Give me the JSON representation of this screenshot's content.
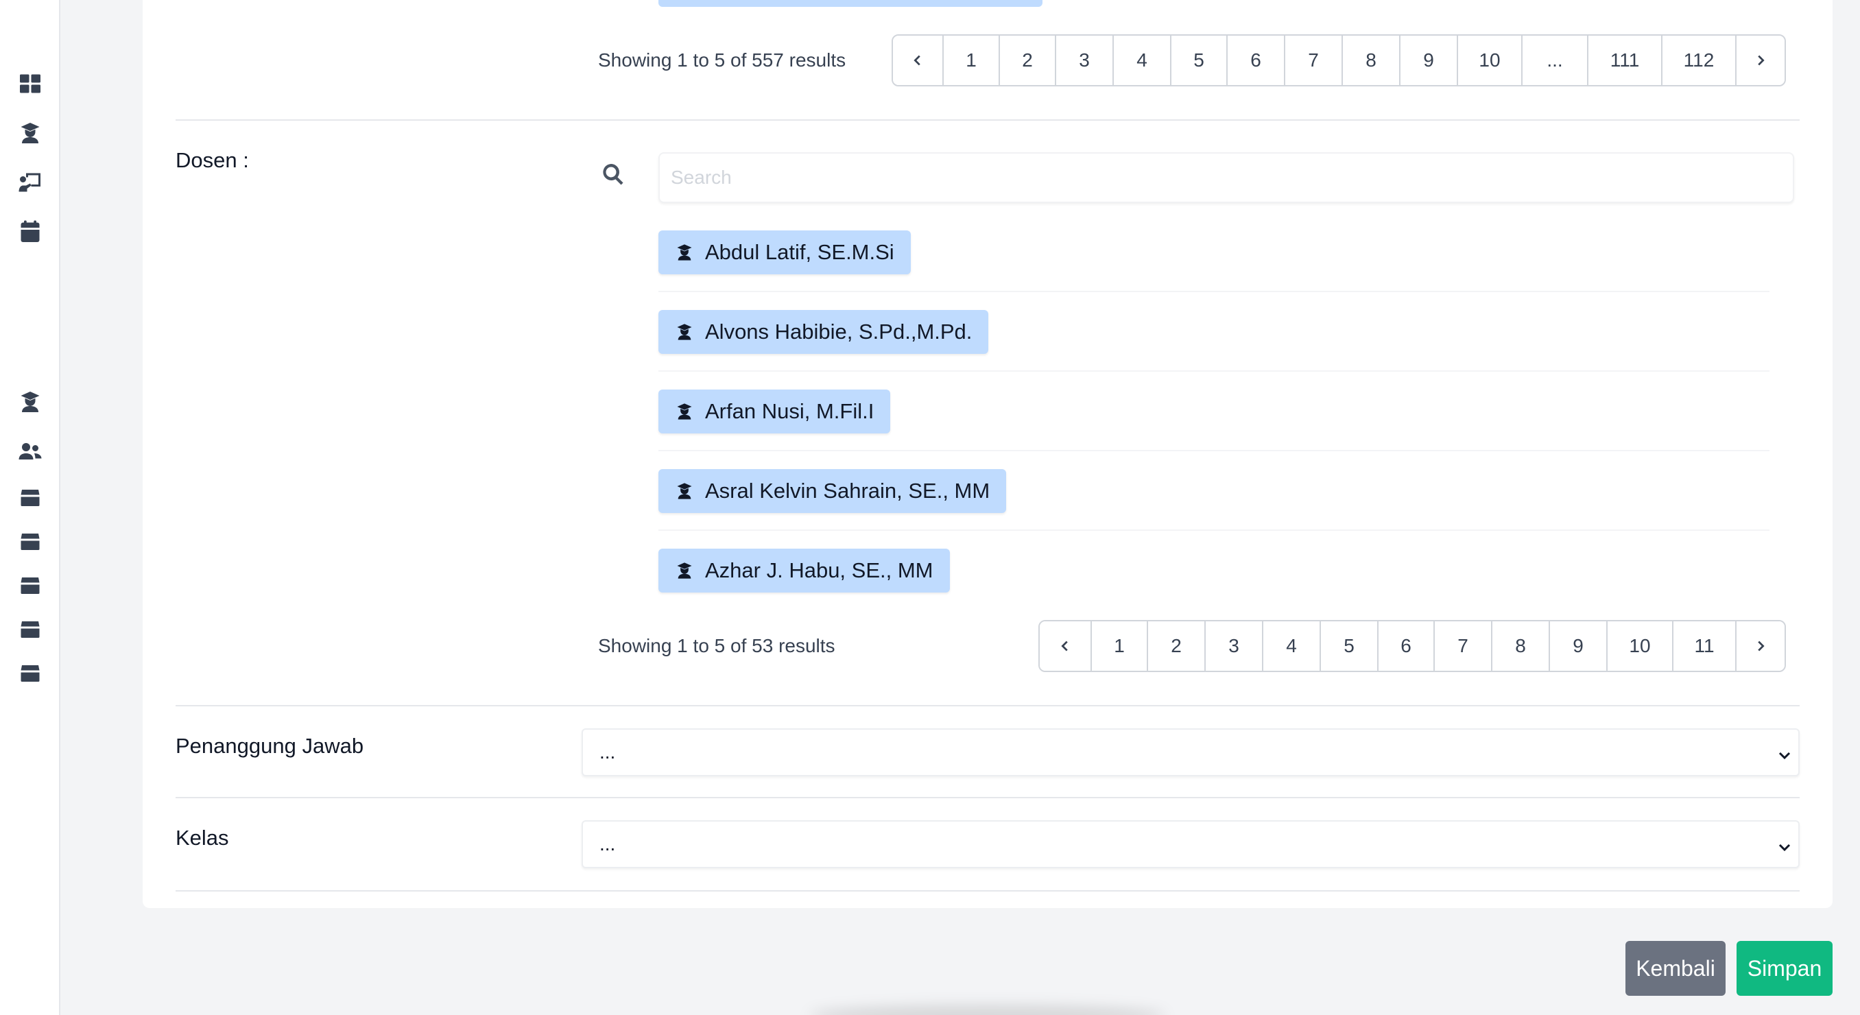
{
  "icons": {
    "sidebar_top": [
      "dashboard-icon",
      "graduate-icon",
      "chalkboard-teacher-icon",
      "calendar-icon"
    ],
    "sidebar_bottom": [
      "graduate-icon",
      "users-icon",
      "box-icon",
      "box-icon",
      "box-icon",
      "box-icon",
      "box-icon"
    ],
    "item_icon": "graduate-icon"
  },
  "mahasiswa_pagination": {
    "showing": "Showing 1 to 5 of 557 results",
    "pages": [
      "1",
      "2",
      "3",
      "4",
      "5",
      "6",
      "7",
      "8",
      "9",
      "10",
      "...",
      "111",
      "112"
    ]
  },
  "dosen": {
    "label": "Dosen :",
    "search_placeholder": "Search",
    "items": [
      "Abdul Latif, SE.M.Si",
      "Alvons Habibie, S.Pd.,M.Pd.",
      "Arfan Nusi, M.Fil.I",
      "Asral Kelvin Sahrain, SE., MM",
      "Azhar J. Habu, SE., MM"
    ],
    "showing": "Showing 1 to 5 of 53 results",
    "pages": [
      "1",
      "2",
      "3",
      "4",
      "5",
      "6",
      "7",
      "8",
      "9",
      "10",
      "11"
    ]
  },
  "penanggung_jawab": {
    "label": "Penanggung Jawab",
    "value": "..."
  },
  "kelas": {
    "label": "Kelas",
    "value": "..."
  },
  "actions": {
    "back_label": "Kembali",
    "save_label": "Simpan"
  },
  "colors": {
    "tag_bg": "#bfdbfe",
    "save": "#10b981",
    "back": "#6b7280"
  }
}
